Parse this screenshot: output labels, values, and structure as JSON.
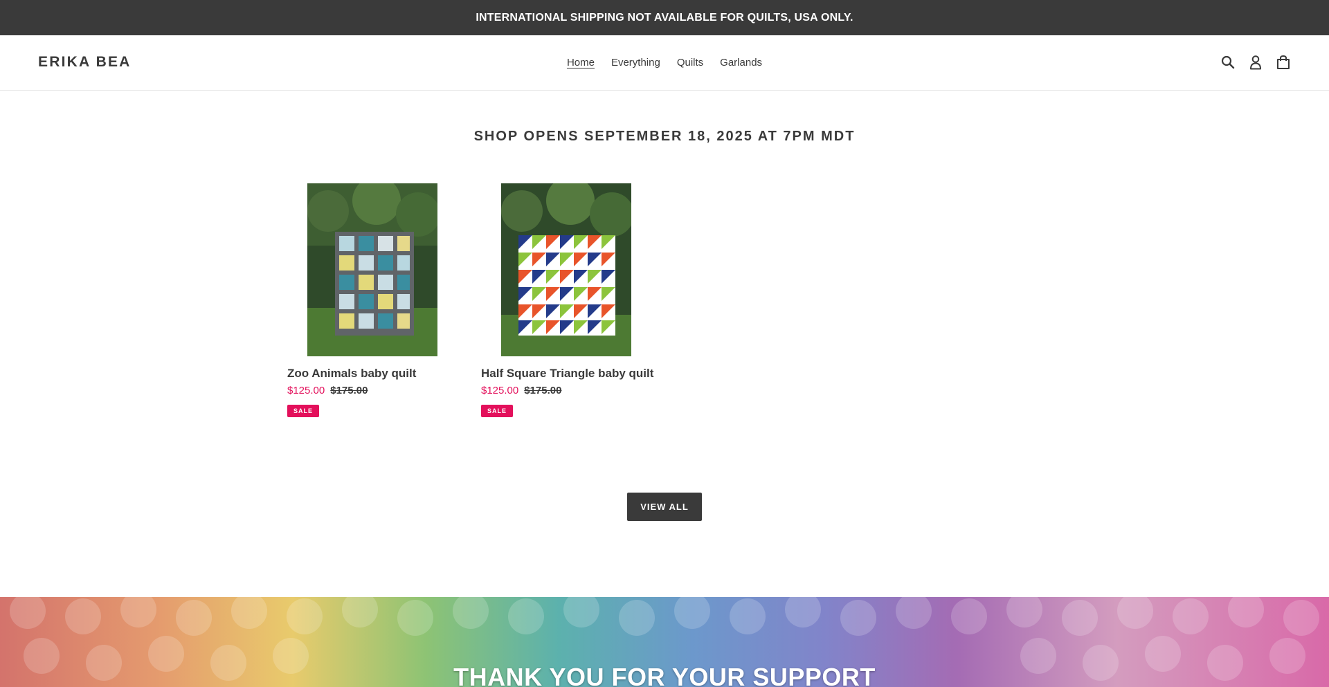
{
  "announcement": {
    "text": "INTERNATIONAL SHIPPING NOT AVAILABLE FOR QUILTS, USA ONLY."
  },
  "header": {
    "logo": "ERIKA BEA",
    "nav": [
      {
        "label": "Home",
        "active": true
      },
      {
        "label": "Everything",
        "active": false
      },
      {
        "label": "Quilts",
        "active": false
      },
      {
        "label": "Garlands",
        "active": false
      }
    ],
    "icons": [
      "search-icon",
      "account-icon",
      "cart-icon"
    ]
  },
  "collection": {
    "title": "SHOP OPENS SEPTEMBER 18, 2025 AT 7PM MDT",
    "products": [
      {
        "title": "Zoo Animals baby quilt",
        "sale_price": "$125.00",
        "original_price": "$175.00",
        "badge": "SALE"
      },
      {
        "title": "Half Square Triangle baby quilt",
        "sale_price": "$125.00",
        "original_price": "$175.00",
        "badge": "SALE"
      }
    ],
    "view_all_label": "VIEW ALL"
  },
  "banner": {
    "heading": "THANK YOU FOR YOUR SUPPORT"
  },
  "colors": {
    "text": "#3a3a3a",
    "sale": "#e3105b",
    "announcement_bg": "#3a3a3a"
  }
}
